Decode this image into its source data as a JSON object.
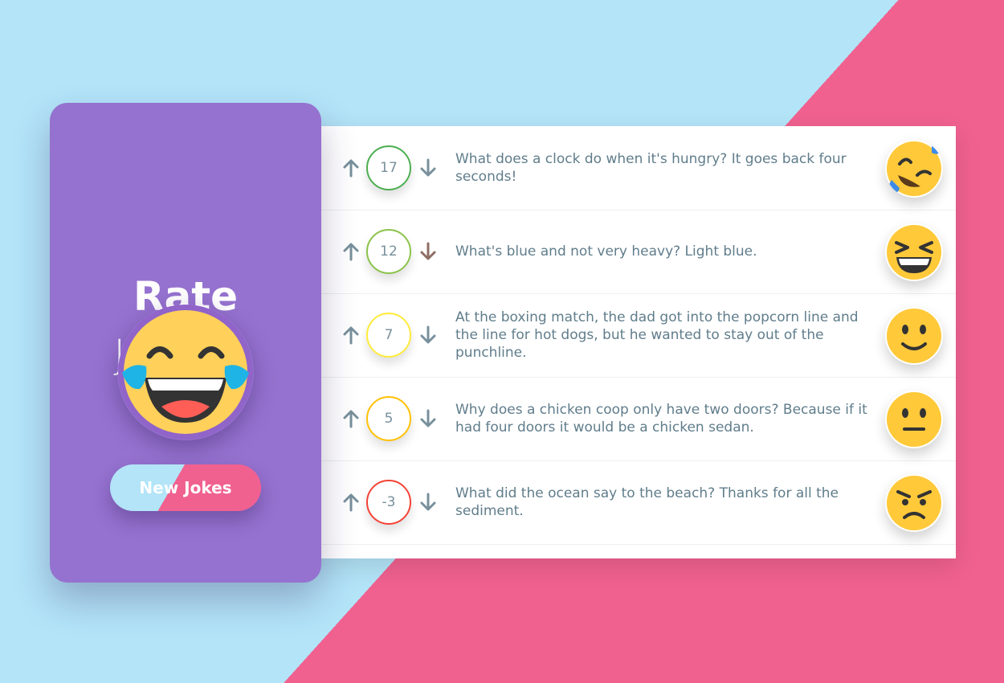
{
  "sidebar": {
    "title_main": "Rate",
    "title_sub": "Jokes",
    "hero_icon": "rolling-laughing-face-icon",
    "new_jokes_label": "New Jokes"
  },
  "colors": {
    "background_left": "#b3e4f8",
    "background_right": "#f06190",
    "sidebar": "#9572cf",
    "text": "#607d8b"
  },
  "jokes": [
    {
      "score": "17",
      "text": "What does a clock do when it's hungry? It goes back four seconds!",
      "emoji": "rolling-on-floor-laughing-icon",
      "ring": "#4caf50",
      "down_arrow": "#78909c"
    },
    {
      "score": "12",
      "text": "What's blue and not very heavy? Light blue.",
      "emoji": "grinning-squinting-face-icon",
      "ring": "#8bc34a",
      "down_arrow": "#8d6e63"
    },
    {
      "score": "7",
      "text": "At the boxing match, the dad got into the popcorn line and the line for hot dogs, but he wanted to stay out of the punchline.",
      "emoji": "slightly-smiling-face-icon",
      "ring": "#ffeb3b",
      "down_arrow": "#78909c"
    },
    {
      "score": "5",
      "text": "Why does a chicken coop only have two doors? Because if it had four doors it would be a chicken sedan.",
      "emoji": "neutral-face-icon",
      "ring": "#ffc107",
      "down_arrow": "#78909c"
    },
    {
      "score": "-3",
      "text": "What did the ocean say to the beach? Thanks for all the sediment.",
      "emoji": "angry-face-icon",
      "ring": "#f44336",
      "down_arrow": "#78909c"
    }
  ]
}
